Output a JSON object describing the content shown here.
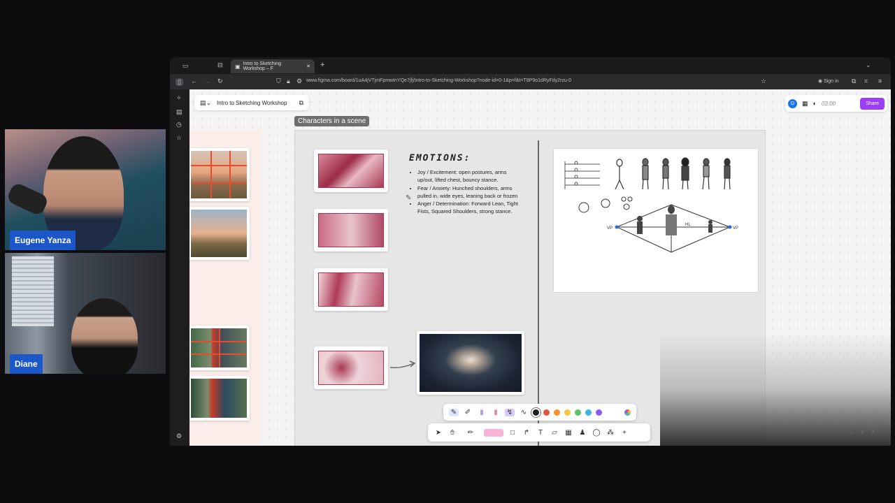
{
  "participants": [
    {
      "name": "Eugene Yanza"
    },
    {
      "name": "Diane"
    }
  ],
  "browser": {
    "tab_title": "Intro to Sketching Workshop – F",
    "url": "www.figma.com/board/1uA4jVTjmFpmwtnYQe7jfj/Intro-to-Sketching-Workshop?node-id=0-1&p=f&t=T8P9o1dRyFdy2rzu-0",
    "sign_in": "Sign in"
  },
  "figma": {
    "file_name": "Intro to Sketching Workshop",
    "avatar_letter": "D",
    "timer": "03:00",
    "share": "Share",
    "section_label": "Characters in a scene"
  },
  "emotions": {
    "title": "EMOTIONS:",
    "items": [
      "Joy / Excitement: open postures, arms up/out, lifted chest, bouncy stance.",
      "Fear / Anxiety: Hunched shoulders, arms pulled in, wide eyes, leaning back or frozen",
      "Anger / Determination: Forward Lean, Tight Fists, Squared Shoulders, strong stance."
    ]
  },
  "sketch_labels": {
    "vp_left": "VP",
    "vp_right": "VP",
    "hl": "HL"
  },
  "colors": {
    "share_purple": "#9b3df0",
    "name_tag_blue": "#1b57c9",
    "palette": [
      "#1e1e1e",
      "#e5533d",
      "#f0922b",
      "#f5c842",
      "#59c26b",
      "#3cb4e6",
      "#8a5cf6"
    ]
  },
  "icons": [
    "pencil-icon",
    "marker-icon",
    "highlighter-icon",
    "eraser-icon",
    "lasso-icon",
    "cursor-icon",
    "hand-icon",
    "pen-icon",
    "shape-icon",
    "connector-icon",
    "text-icon",
    "sticky-icon",
    "table-icon",
    "stamp-icon",
    "comment-icon",
    "widgets-icon",
    "plus-icon",
    "zoom-out-icon",
    "zoom-in-icon",
    "help-icon",
    "settings-icon"
  ]
}
